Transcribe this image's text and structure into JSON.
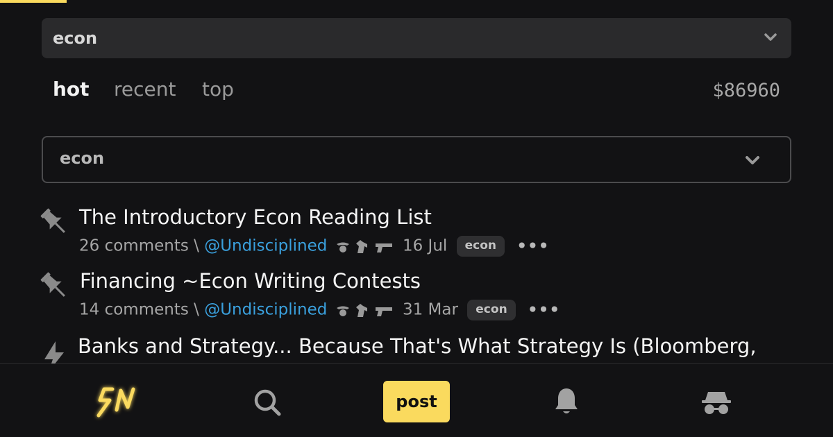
{
  "territory_select": {
    "value": "econ"
  },
  "sort": {
    "tabs": [
      "hot",
      "recent",
      "top"
    ],
    "active": "hot",
    "sats": "$86960"
  },
  "sub_select": {
    "value": "econ"
  },
  "items": [
    {
      "title": "The Introductory Econ Reading List",
      "comments": "26 comments",
      "separator": "\\",
      "user": "@Undisciplined",
      "date": "16 Jul",
      "tag": "econ",
      "more": "•••",
      "icon": "pin-icon"
    },
    {
      "title": "Financing ~Econ Writing Contests",
      "comments": "14 comments",
      "separator": "\\",
      "user": "@Undisciplined",
      "date": "31 Mar",
      "tag": "econ",
      "more": "•••",
      "icon": "pin-icon"
    },
    {
      "title": "Banks and Strategy... Because That's What Strategy Is (Bloomberg,",
      "icon": "bolt-icon"
    }
  ],
  "nav": {
    "post_label": "post",
    "logo_text": "SN"
  },
  "colors": {
    "accent": "#fada5e",
    "link": "#3aa0dd",
    "background": "#121214"
  }
}
